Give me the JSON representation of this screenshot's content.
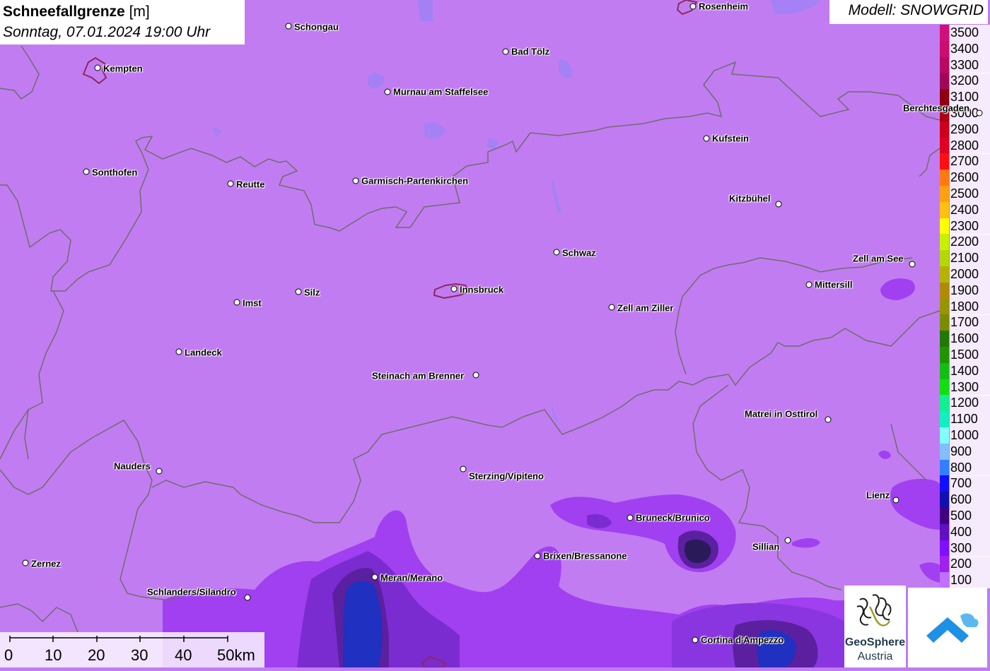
{
  "title": {
    "parameter": "Schneefallgrenze",
    "unit": "[m]",
    "datetime": "Sonntag, 07.01.2024 19:00 Uhr"
  },
  "model_label": "Modell: SNOWGRID",
  "legend": [
    {
      "label": "3500",
      "color": "#d0107a"
    },
    {
      "label": "3400",
      "color": "#cc0c6e"
    },
    {
      "label": "3300",
      "color": "#b80a60"
    },
    {
      "label": "3200",
      "color": "#a00855"
    },
    {
      "label": "3100",
      "color": "#8e0010"
    },
    {
      "label": "3000",
      "color": "#b00010"
    },
    {
      "label": "2900",
      "color": "#cc0018"
    },
    {
      "label": "2800",
      "color": "#e00020"
    },
    {
      "label": "2700",
      "color": "#ff1010"
    },
    {
      "label": "2600",
      "color": "#ff7a10"
    },
    {
      "label": "2500",
      "color": "#ffa010"
    },
    {
      "label": "2400",
      "color": "#ffc010"
    },
    {
      "label": "2300",
      "color": "#ffff00"
    },
    {
      "label": "2200",
      "color": "#c8f000"
    },
    {
      "label": "2100",
      "color": "#b4d800"
    },
    {
      "label": "2000",
      "color": "#b4b400"
    },
    {
      "label": "1900",
      "color": "#b08c00"
    },
    {
      "label": "1800",
      "color": "#989600"
    },
    {
      "label": "1700",
      "color": "#7a8c00"
    },
    {
      "label": "1600",
      "color": "#1e7a00"
    },
    {
      "label": "1500",
      "color": "#1e9600"
    },
    {
      "label": "1400",
      "color": "#10c010"
    },
    {
      "label": "1300",
      "color": "#10e010"
    },
    {
      "label": "1200",
      "color": "#10f090"
    },
    {
      "label": "1100",
      "color": "#10f0c0"
    },
    {
      "label": "1000",
      "color": "#80ffff"
    },
    {
      "label": "900",
      "color": "#80c0ff"
    },
    {
      "label": "800",
      "color": "#3080ff"
    },
    {
      "label": "700",
      "color": "#1010ff"
    },
    {
      "label": "600",
      "color": "#1010b0"
    },
    {
      "label": "500",
      "color": "#400080"
    },
    {
      "label": "400",
      "color": "#6010c0"
    },
    {
      "label": "300",
      "color": "#8010ff"
    },
    {
      "label": "200",
      "color": "#a020f0"
    },
    {
      "label": "100",
      "color": "#c070ff"
    }
  ],
  "cities": [
    {
      "name": "Rosenheim",
      "side": "right"
    },
    {
      "name": "Schongau",
      "side": "right"
    },
    {
      "name": "Bad Tölz",
      "side": "right"
    },
    {
      "name": "Kempten",
      "side": "right"
    },
    {
      "name": "Murnau am Staffelsee",
      "side": "right"
    },
    {
      "name": "Berchtesgaden",
      "side": "left"
    },
    {
      "name": "Kufstein",
      "side": "right"
    },
    {
      "name": "Sonthofen",
      "side": "right"
    },
    {
      "name": "Reutte",
      "side": "right"
    },
    {
      "name": "Garmisch-Partenkirchen",
      "side": "right"
    },
    {
      "name": "Kitzbühel",
      "side": "left"
    },
    {
      "name": "Schwaz",
      "side": "right"
    },
    {
      "name": "Zell am See",
      "side": "left"
    },
    {
      "name": "Mittersill",
      "side": "right"
    },
    {
      "name": "Silz",
      "side": "right"
    },
    {
      "name": "Innsbruck",
      "side": "right"
    },
    {
      "name": "Imst",
      "side": "right"
    },
    {
      "name": "Zell am Ziller",
      "side": "right"
    },
    {
      "name": "Landeck",
      "side": "right"
    },
    {
      "name": "Steinach am Brenner",
      "side": "left"
    },
    {
      "name": "Matrei in Osttirol",
      "side": "left"
    },
    {
      "name": "Nauders",
      "side": "left"
    },
    {
      "name": "Sterzing/Vipiteno",
      "side": "right"
    },
    {
      "name": "Lienz",
      "side": "left"
    },
    {
      "name": "Bruneck/Brunico",
      "side": "right"
    },
    {
      "name": "Sillian",
      "side": "left"
    },
    {
      "name": "Brixen/Bressanone",
      "side": "right"
    },
    {
      "name": "Zernez",
      "side": "right"
    },
    {
      "name": "Meran/Merano",
      "side": "right"
    },
    {
      "name": "Schlanders/Silandro",
      "side": "left"
    },
    {
      "name": "Cortina d'Ampezzo",
      "side": "right"
    }
  ],
  "scale": [
    "0",
    "10",
    "20",
    "30",
    "40",
    "50km"
  ],
  "logo": {
    "line1": "GeoSphere",
    "line2": "Austria"
  }
}
